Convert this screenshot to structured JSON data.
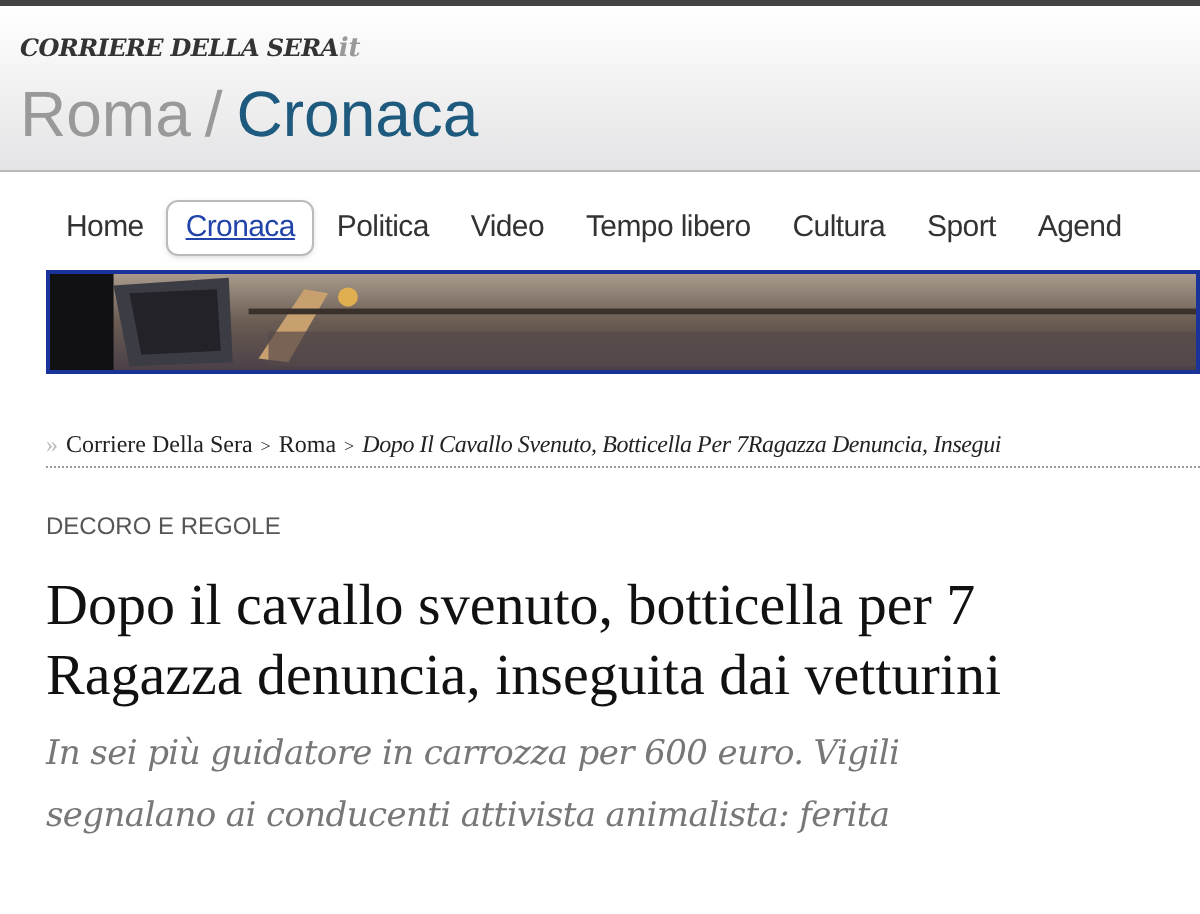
{
  "header": {
    "logo": "CORRIERE DELLA SERA",
    "logo_suffix": "it",
    "section": "Roma",
    "separator": "/",
    "subsection": "Cronaca"
  },
  "nav": [
    {
      "label": "Home",
      "selected": false
    },
    {
      "label": "Cronaca",
      "selected": true
    },
    {
      "label": "Politica",
      "selected": false
    },
    {
      "label": "Video",
      "selected": false
    },
    {
      "label": "Tempo libero",
      "selected": false
    },
    {
      "label": "Cultura",
      "selected": false
    },
    {
      "label": "Sport",
      "selected": false
    },
    {
      "label": "Agend",
      "selected": false
    }
  ],
  "breadcrumb": {
    "marker": "»",
    "items": [
      "Corriere Della Sera",
      "Roma"
    ],
    "separator": ">",
    "current": "Dopo Il Cavallo Svenuto, Botticella Per 7Ragazza Denuncia, Insegui"
  },
  "article": {
    "kicker": "DECORO E REGOLE",
    "headline": [
      "Dopo il cavallo svenuto, botticella per 7",
      "Ragazza denuncia, inseguita dai vetturini"
    ],
    "summary": [
      "In sei più guidatore in carrozza per 600 euro. Vigili",
      "segnalano ai conducenti attivista animalista: ferita"
    ]
  }
}
